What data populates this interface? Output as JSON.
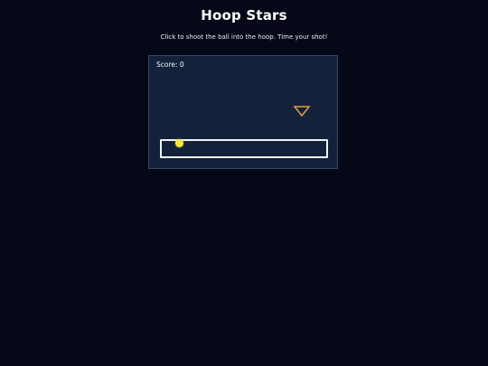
{
  "header": {
    "title": "Hoop Stars",
    "instructions": "Click to shoot the ball into the hoop. Time your shot!"
  },
  "game": {
    "score_label": "Score: 0",
    "score": 0,
    "colors": {
      "background": "#050816",
      "court": "#13223a",
      "hoop": "#d99a3e",
      "ball": "#f8e63a",
      "track": "#f2f4f8"
    },
    "icons": {
      "hoop": "hoop-triangle-icon",
      "ball": "ball-icon"
    }
  }
}
